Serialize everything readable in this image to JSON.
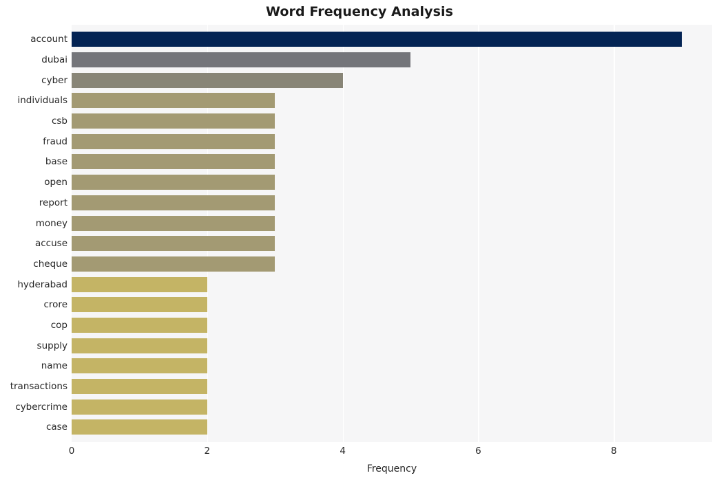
{
  "chart_data": {
    "type": "bar",
    "orientation": "horizontal",
    "title": "Word Frequency Analysis",
    "xlabel": "Frequency",
    "ylabel": "",
    "categories": [
      "account",
      "dubai",
      "cyber",
      "individuals",
      "csb",
      "fraud",
      "base",
      "open",
      "report",
      "money",
      "accuse",
      "cheque",
      "hyderabad",
      "crore",
      "cop",
      "supply",
      "name",
      "transactions",
      "cybercrime",
      "case"
    ],
    "values": [
      9,
      5,
      4,
      3,
      3,
      3,
      3,
      3,
      3,
      3,
      3,
      3,
      2,
      2,
      2,
      2,
      2,
      2,
      2,
      2
    ],
    "bar_colors": [
      "#042454",
      "#74757a",
      "#888577",
      "#a39a73",
      "#a39a73",
      "#a39a73",
      "#a39a73",
      "#a39a73",
      "#a39a73",
      "#a39a73",
      "#a39a73",
      "#a39a73",
      "#c4b465",
      "#c4b465",
      "#c4b465",
      "#c4b465",
      "#c4b465",
      "#c4b465",
      "#c4b465",
      "#c4b465"
    ],
    "xlim": [
      0,
      9.45
    ],
    "xticks": [
      0,
      2,
      4,
      6,
      8
    ],
    "xtick_labels": [
      "0",
      "2",
      "4",
      "6",
      "8"
    ],
    "grid": true,
    "grid_color": "#ffffff",
    "plot_background": "#f6f6f7",
    "figure_background": "#ffffff",
    "legend": null
  }
}
